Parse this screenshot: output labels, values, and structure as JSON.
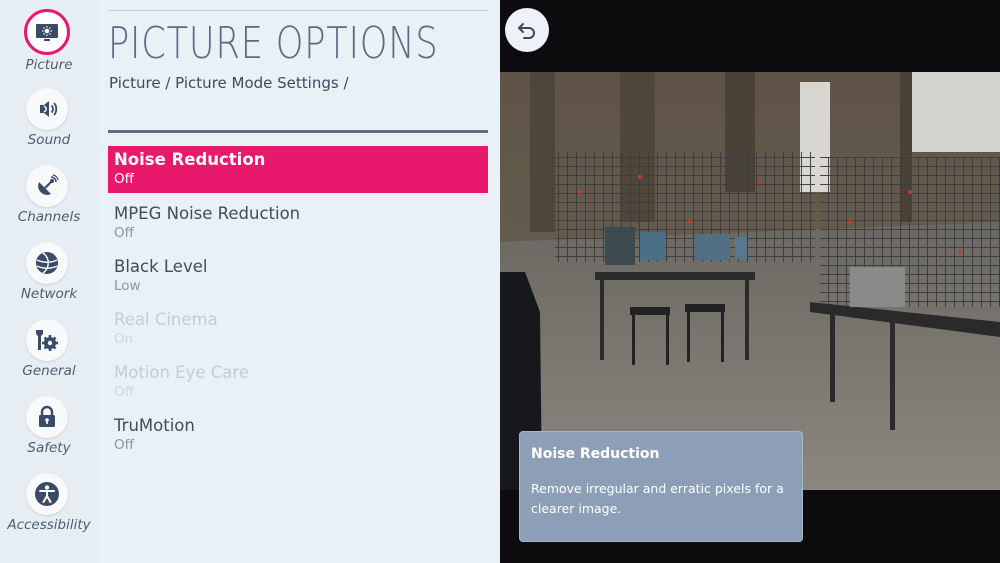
{
  "sidebar": {
    "items": [
      {
        "label": "Picture",
        "icon": "picture-icon",
        "active": true
      },
      {
        "label": "Sound",
        "icon": "sound-icon"
      },
      {
        "label": "Channels",
        "icon": "channels-icon"
      },
      {
        "label": "Network",
        "icon": "network-icon"
      },
      {
        "label": "General",
        "icon": "general-icon"
      },
      {
        "label": "Safety",
        "icon": "safety-icon"
      },
      {
        "label": "Accessibility",
        "icon": "accessibility-icon"
      }
    ]
  },
  "panel": {
    "title": "PICTURE OPTIONS",
    "breadcrumb": "Picture / Picture Mode Settings /"
  },
  "menu": {
    "items": [
      {
        "title": "Noise Reduction",
        "value": "Off",
        "state": "selected"
      },
      {
        "title": "MPEG Noise Reduction",
        "value": "Off",
        "state": "enabled"
      },
      {
        "title": "Black Level",
        "value": "Low",
        "state": "enabled"
      },
      {
        "title": "Real Cinema",
        "value": "On",
        "state": "disabled"
      },
      {
        "title": "Motion Eye Care",
        "value": "Off",
        "state": "disabled"
      },
      {
        "title": "TruMotion",
        "value": "Off",
        "state": "enabled"
      }
    ]
  },
  "back_button": {
    "icon": "back-arrow-icon"
  },
  "tooltip": {
    "title": "Noise Reduction",
    "text": "Remove irregular and erratic pixels for a clearer image."
  },
  "colors": {
    "accent": "#e8186d",
    "panel_bg": "#e9f0f6",
    "tooltip_bg": "#8d9fb7"
  }
}
